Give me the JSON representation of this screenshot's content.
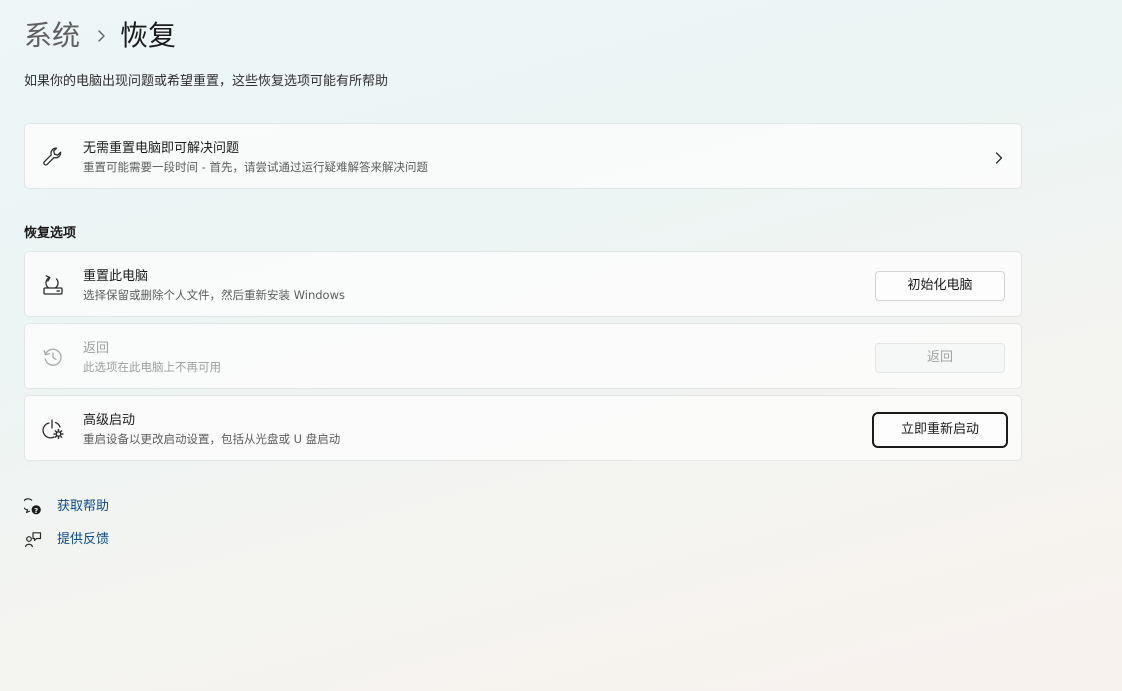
{
  "breadcrumb": {
    "parent": "系统",
    "current": "恢复"
  },
  "subtitle": "如果你的电脑出现问题或希望重置，这些恢复选项可能有所帮助",
  "fix_card": {
    "icon": "wrench-icon",
    "title": "无需重置电脑即可解决问题",
    "description": "重置可能需要一段时间 - 首先，请尝试通过运行疑难解答来解决问题"
  },
  "recovery_section": {
    "header": "恢复选项",
    "items": [
      {
        "icon": "reset-pc-icon",
        "title": "重置此电脑",
        "description": "选择保留或删除个人文件，然后重新安装 Windows",
        "button_label": "初始化电脑",
        "enabled": true
      },
      {
        "icon": "history-icon",
        "title": "返回",
        "description": "此选项在此电脑上不再可用",
        "button_label": "返回",
        "enabled": false
      },
      {
        "icon": "advanced-startup-icon",
        "title": "高级启动",
        "description": "重启设备以更改启动设置，包括从光盘或 U 盘启动",
        "button_label": "立即重新启动",
        "enabled": true,
        "focused": true
      }
    ]
  },
  "links": [
    {
      "icon": "get-help-icon",
      "label": "获取帮助"
    },
    {
      "icon": "feedback-icon",
      "label": "提供反馈"
    }
  ],
  "colors": {
    "link": "#0a4a8a",
    "text": "#1b1b1b",
    "secondary_text": "#5d5d5d",
    "disabled_text": "#9f9f9f"
  }
}
